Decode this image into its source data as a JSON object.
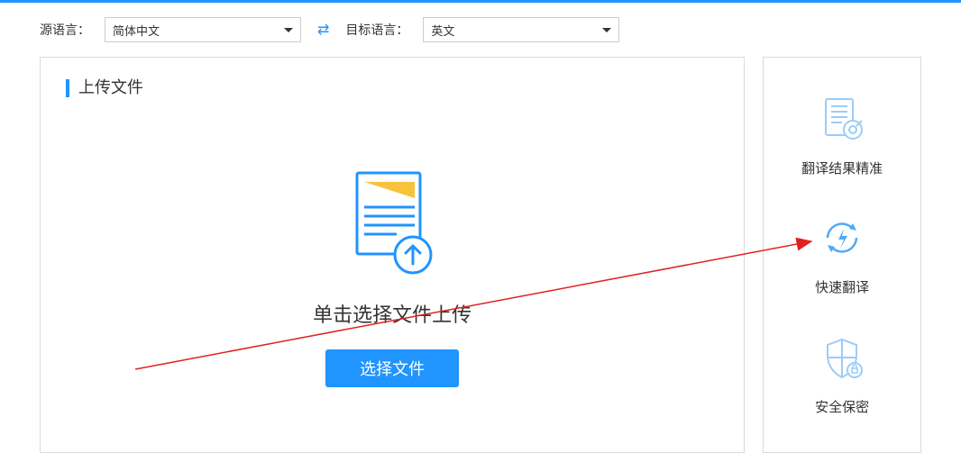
{
  "lang": {
    "src_label": "源语言：",
    "src_value": "简体中文",
    "tgt_label": "目标语言：",
    "tgt_value": "英文"
  },
  "panel": {
    "title": "上传文件",
    "hint": "单击选择文件上传",
    "button": "选择文件"
  },
  "features": {
    "f1": "翻译结果精准",
    "f2": "快速翻译",
    "f3": "安全保密"
  }
}
